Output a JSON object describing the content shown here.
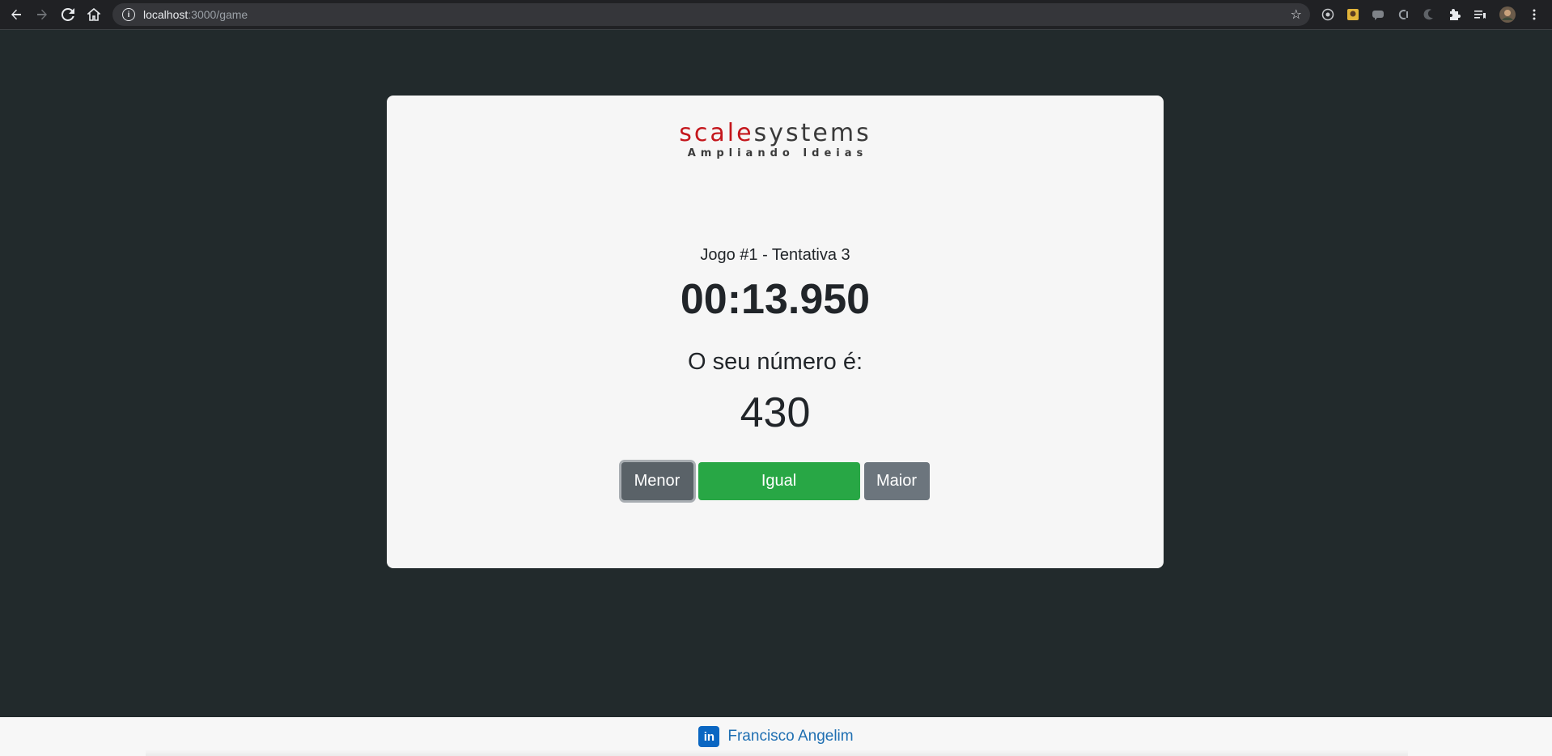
{
  "browser": {
    "url_host": "localhost",
    "url_path": ":3000/game",
    "info_icon": "i",
    "star_icon": "☆"
  },
  "logo": {
    "part1": "scale",
    "part2": "systems",
    "tagline": "Ampliando Ideias",
    "colors": {
      "scale": "#c4161c",
      "systems": "#3a3a3a"
    }
  },
  "game": {
    "title": "Jogo #1 - Tentativa 3",
    "timer": "00:13.950",
    "prompt": "O seu número é:",
    "number": "430"
  },
  "buttons": {
    "menor": "Menor",
    "igual": "Igual",
    "maior": "Maior"
  },
  "footer": {
    "linkedin_icon": "in",
    "name": "Francisco Angelim"
  },
  "colors": {
    "background": "#222a2c",
    "card": "#f6f6f6",
    "success": "#28a745",
    "secondary": "#6c757d",
    "link": "#1f6fb2"
  }
}
